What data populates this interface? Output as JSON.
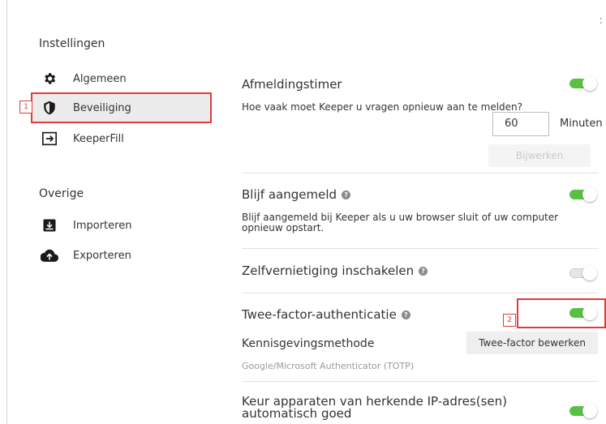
{
  "close_glyph": ":",
  "sidebar": {
    "settings_title": "Instellingen",
    "items": [
      {
        "label": "Algemeen",
        "icon": "gear-icon"
      },
      {
        "label": "Beveiliging",
        "icon": "shield-icon"
      },
      {
        "label": "KeeperFill",
        "icon": "keeperfill-icon"
      }
    ],
    "other_title": "Overige",
    "other_items": [
      {
        "label": "Importeren",
        "icon": "import-icon"
      },
      {
        "label": "Exporteren",
        "icon": "cloud-upload-icon"
      }
    ],
    "marker_label": "1"
  },
  "main": {
    "logout_timer": {
      "title": "Afmeldingstimer",
      "description": "Hoe vaak moet Keeper u vragen opnieuw aan te melden?",
      "value": "60",
      "unit": "Minuten",
      "update_button": "Bijwerken",
      "enabled": true
    },
    "stay_logged_in": {
      "title": "Blijf aangemeld",
      "description_line1": "Blijf aangemeld bij Keeper als u uw browser sluit of uw computer",
      "description_line2": "opnieuw opstart.",
      "enabled": true
    },
    "self_destruct": {
      "title": "Zelfvernietiging inschakelen",
      "enabled": false
    },
    "two_factor": {
      "title": "Twee-factor-authenticatie",
      "enabled": true,
      "marker_label": "2",
      "method_label": "Kennisgevingsmethode",
      "method_value": "Google/Microsoft Authenticator (TOTP)",
      "edit_button": "Twee-factor bewerken"
    },
    "approve_devices": {
      "title_line1": "Keur apparaten van herkende IP-adres(sen)",
      "title_line2": "automatisch goed",
      "enabled": true
    },
    "help_glyph": "?"
  },
  "colors": {
    "toggle_on": "#58c144",
    "highlight": "#e23b3b"
  }
}
